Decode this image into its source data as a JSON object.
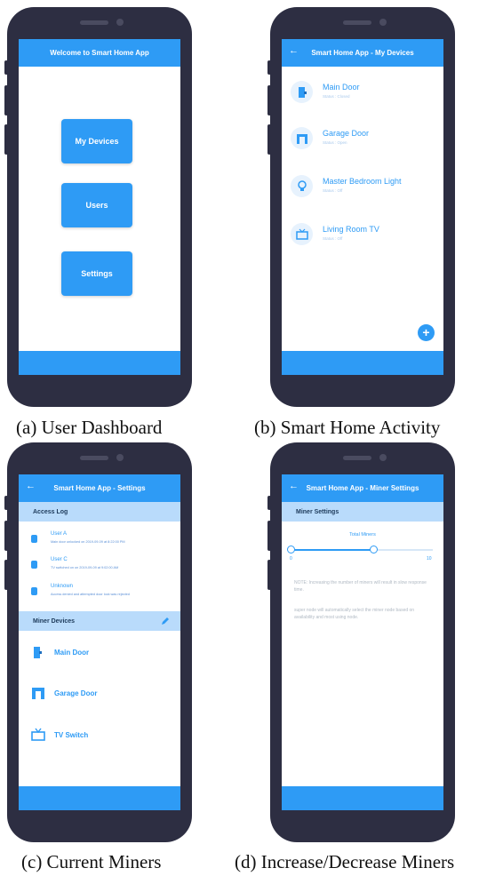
{
  "screens": {
    "dashboard": {
      "title": "Welcome to Smart Home App",
      "buttons": [
        "My Devices",
        "Users",
        "Settings"
      ],
      "caption": "(a) User Dashboard"
    },
    "devices": {
      "title": "Smart Home App - My Devices",
      "back_icon": "←",
      "items": [
        {
          "name": "Main Door",
          "status": "Status : Closed"
        },
        {
          "name": "Garage Door",
          "status": "Status : Open"
        },
        {
          "name": "Master Bedroom Light",
          "status": "Status : Off"
        },
        {
          "name": "Living Room TV",
          "status": "Status : Off"
        }
      ],
      "fab_label": "+",
      "caption": "(b) Smart Home Activity"
    },
    "settings": {
      "title": "Smart Home App - Settings",
      "back_icon": "←",
      "access_log_label": "Access Log",
      "log": [
        {
          "name": "User A",
          "detail": "Main door unlocked on 2019-09-09 at 8:22:00 PM"
        },
        {
          "name": "User C",
          "detail": "TV switched on on 2019-09-09 at 9:02:00 AM"
        },
        {
          "name": "Unknown",
          "detail": "Access denied and attempted door lock was rejected"
        }
      ],
      "miner_devices_label": "Miner Devices",
      "miners": [
        "Main Door",
        "Garage Door",
        "TV Switch"
      ],
      "caption": "(c) Current Miners"
    },
    "miner_settings": {
      "title": "Smart Home App - Miner Settings",
      "back_icon": "←",
      "section_label": "Miner Settings",
      "slider_label": "Total Miners",
      "slider_min": "0",
      "slider_max": "10",
      "slider_value_fraction": 0.58,
      "note1": "NOTE: Increasing the number of miners will result in slow response time.",
      "note2": "super node will automatically select the miner node based on availability and most using node.",
      "caption": "(d) Increase/Decrease Miners"
    }
  },
  "colors": {
    "accent": "#2e9bf5",
    "phone": "#2d2e42",
    "section": "#b9dbfb"
  }
}
